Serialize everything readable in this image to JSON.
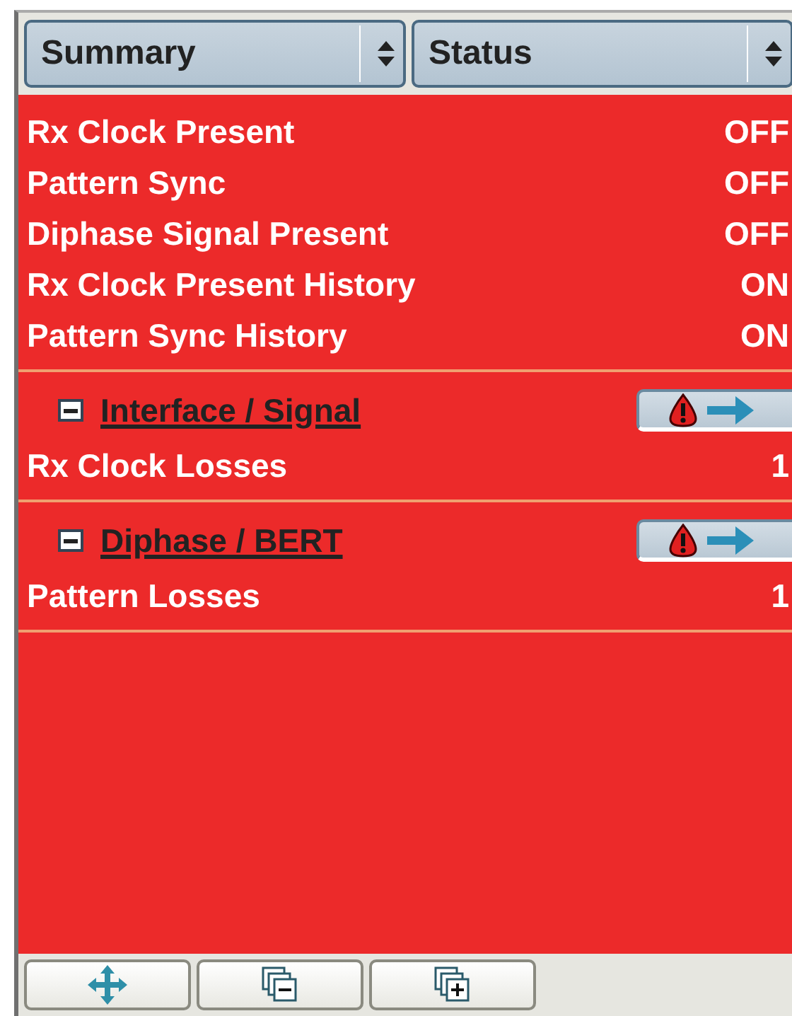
{
  "columns": [
    {
      "label": "Summary"
    },
    {
      "label": "Status"
    }
  ],
  "summary_rows": [
    {
      "label": "Rx Clock Present",
      "value": "OFF"
    },
    {
      "label": "Pattern Sync",
      "value": "OFF"
    },
    {
      "label": "Diphase Signal Present",
      "value": "OFF"
    },
    {
      "label": "Rx Clock Present History",
      "value": "ON"
    },
    {
      "label": "Pattern Sync History",
      "value": "ON"
    }
  ],
  "groups": [
    {
      "title": "Interface / Signal",
      "expanded": true,
      "rows": [
        {
          "label": "Rx Clock Losses",
          "value": "1"
        }
      ]
    },
    {
      "title": "Diphase / BERT",
      "expanded": true,
      "rows": [
        {
          "label": "Pattern Losses",
          "value": "1"
        }
      ]
    }
  ]
}
